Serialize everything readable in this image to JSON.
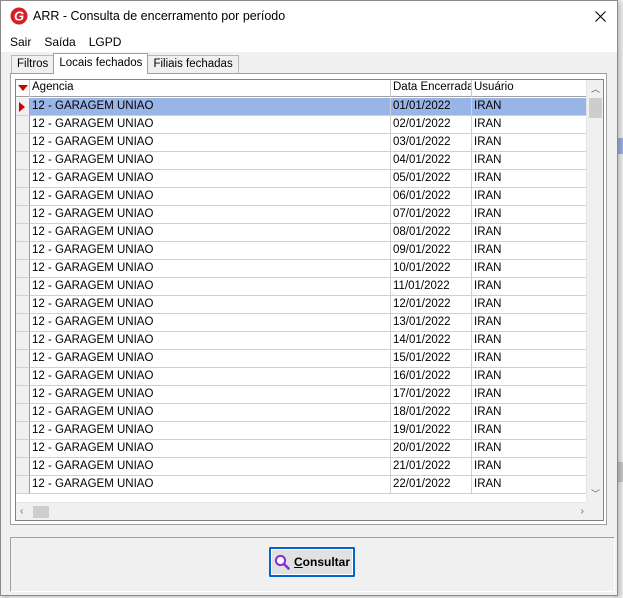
{
  "window": {
    "title": "ARR - Consulta de encerramento por período",
    "close_glyph": "✕"
  },
  "menu": [
    "Sair",
    "Saída",
    "LGPD"
  ],
  "tabs": [
    {
      "label": "Filtros",
      "active": false
    },
    {
      "label": "Locais fechados",
      "active": true
    },
    {
      "label": "Filiais fechadas",
      "active": false
    }
  ],
  "grid": {
    "columns": [
      "Agencia",
      "Data Encerrada",
      "Usuário"
    ],
    "selected_row": 0,
    "rows": [
      [
        "12 - GARAGEM UNIAO",
        "01/01/2022",
        "IRAN"
      ],
      [
        "12 - GARAGEM UNIAO",
        "02/01/2022",
        "IRAN"
      ],
      [
        "12 - GARAGEM UNIAO",
        "03/01/2022",
        "IRAN"
      ],
      [
        "12 - GARAGEM UNIAO",
        "04/01/2022",
        "IRAN"
      ],
      [
        "12 - GARAGEM UNIAO",
        "05/01/2022",
        "IRAN"
      ],
      [
        "12 - GARAGEM UNIAO",
        "06/01/2022",
        "IRAN"
      ],
      [
        "12 - GARAGEM UNIAO",
        "07/01/2022",
        "IRAN"
      ],
      [
        "12 - GARAGEM UNIAO",
        "08/01/2022",
        "IRAN"
      ],
      [
        "12 - GARAGEM UNIAO",
        "09/01/2022",
        "IRAN"
      ],
      [
        "12 - GARAGEM UNIAO",
        "10/01/2022",
        "IRAN"
      ],
      [
        "12 - GARAGEM UNIAO",
        "11/01/2022",
        "IRAN"
      ],
      [
        "12 - GARAGEM UNIAO",
        "12/01/2022",
        "IRAN"
      ],
      [
        "12 - GARAGEM UNIAO",
        "13/01/2022",
        "IRAN"
      ],
      [
        "12 - GARAGEM UNIAO",
        "14/01/2022",
        "IRAN"
      ],
      [
        "12 - GARAGEM UNIAO",
        "15/01/2022",
        "IRAN"
      ],
      [
        "12 - GARAGEM UNIAO",
        "16/01/2022",
        "IRAN"
      ],
      [
        "12 - GARAGEM UNIAO",
        "17/01/2022",
        "IRAN"
      ],
      [
        "12 - GARAGEM UNIAO",
        "18/01/2022",
        "IRAN"
      ],
      [
        "12 - GARAGEM UNIAO",
        "19/01/2022",
        "IRAN"
      ],
      [
        "12 - GARAGEM UNIAO",
        "20/01/2022",
        "IRAN"
      ],
      [
        "12 - GARAGEM UNIAO",
        "21/01/2022",
        "IRAN"
      ],
      [
        "12 - GARAGEM UNIAO",
        "22/01/2022",
        "IRAN"
      ]
    ]
  },
  "consult_button": {
    "label": "Consultar",
    "icon": "search-icon"
  },
  "colors": {
    "selection": "#99b4e6",
    "marker": "#d40000",
    "focus_border": "#0066cc"
  }
}
